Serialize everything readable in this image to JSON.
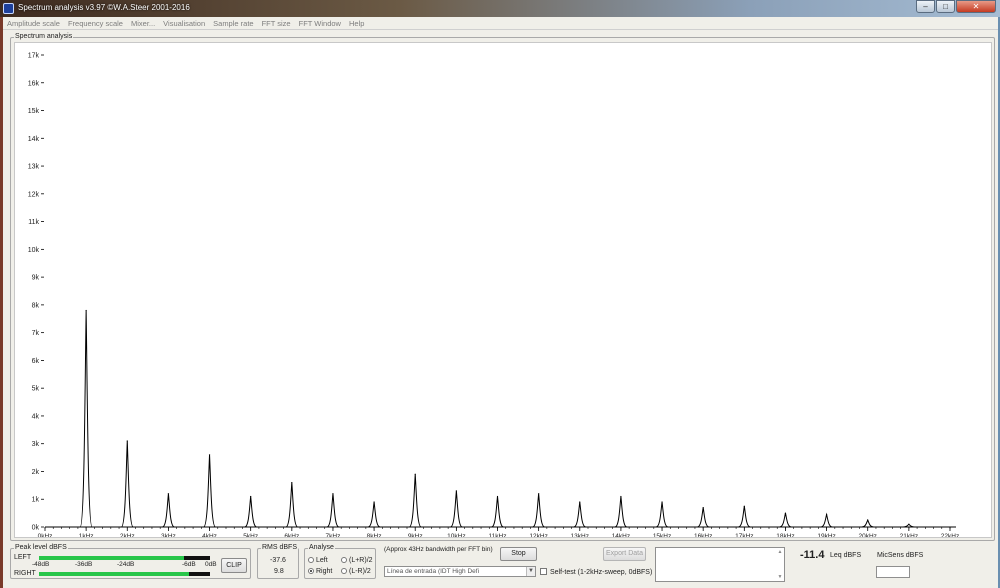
{
  "window": {
    "title": "Spectrum analysis v3.97   ©W.A.Steer 2001-2016",
    "controls": [
      "–",
      "□",
      "✕"
    ]
  },
  "menu": [
    "Amplitude scale",
    "Frequency scale",
    "Mixer...",
    "Visualisation",
    "Sample rate",
    "FFT size",
    "FFT Window",
    "Help"
  ],
  "spectrum": {
    "group_title": "Spectrum analysis",
    "y_ticks": [
      "0k",
      "1k",
      "2k",
      "3k",
      "4k",
      "5k",
      "6k",
      "7k",
      "8k",
      "9k",
      "10k",
      "11k",
      "12k",
      "13k",
      "14k",
      "15k",
      "16k",
      "17k"
    ],
    "x_ticks": [
      "0kHz",
      "1kHz",
      "2kHz",
      "3kHz",
      "4kHz",
      "5kHz",
      "6kHz",
      "7kHz",
      "8kHz",
      "9kHz",
      "10kHz",
      "11kHz",
      "12kHz",
      "13kHz",
      "14kHz",
      "15kHz",
      "16kHz",
      "17kHz",
      "18kHz",
      "19kHz",
      "20kHz",
      "21kHz",
      "22kHz"
    ],
    "colors": {
      "trace": "#000000",
      "background": "#ffffff"
    }
  },
  "chart_data": {
    "type": "line",
    "x_unit": "kHz",
    "xlim": [
      0,
      22
    ],
    "ylim": [
      0,
      17
    ],
    "peaks": [
      {
        "x": 1,
        "y": 7.8
      },
      {
        "x": 2,
        "y": 3.1
      },
      {
        "x": 3,
        "y": 1.2
      },
      {
        "x": 4,
        "y": 2.6
      },
      {
        "x": 5,
        "y": 1.1
      },
      {
        "x": 6,
        "y": 1.6
      },
      {
        "x": 7,
        "y": 1.2
      },
      {
        "x": 8,
        "y": 0.9
      },
      {
        "x": 9,
        "y": 1.9
      },
      {
        "x": 10,
        "y": 1.3
      },
      {
        "x": 11,
        "y": 1.1
      },
      {
        "x": 12,
        "y": 1.2
      },
      {
        "x": 13,
        "y": 0.9
      },
      {
        "x": 14,
        "y": 1.1
      },
      {
        "x": 15,
        "y": 0.9
      },
      {
        "x": 16,
        "y": 0.7
      },
      {
        "x": 17,
        "y": 0.75
      },
      {
        "x": 18,
        "y": 0.5
      },
      {
        "x": 19,
        "y": 0.45
      },
      {
        "x": 20,
        "y": 0.25
      },
      {
        "x": 21,
        "y": 0.1
      }
    ]
  },
  "peak_level": {
    "title": "Peak level dBFS",
    "left_label": "LEFT",
    "right_label": "RIGHT",
    "scale": [
      "-48dB",
      "-36dB",
      "-24dB",
      "-6dB",
      "0dB"
    ],
    "left_fraction": 0.85,
    "right_fraction": 0.88,
    "clip_label": "CLIP"
  },
  "rms": {
    "title": "RMS dBFS",
    "left": "-37.6",
    "right": "9.8"
  },
  "analyse": {
    "title": "Analyse",
    "options": [
      "Left",
      "(L+R)/2",
      "Right",
      "(L-R)/2"
    ],
    "selected": "Right"
  },
  "fft_info": "(Approx 43Hz bandwidth per FFT bin)",
  "stop_label": "Stop",
  "export_label": "Export Data",
  "input_select": "Línea de entrada (IDT High Defi",
  "selftest_label": "Self-test (1-2kHz-sweep, 0dBFS)",
  "leq": {
    "value": "-11.4",
    "label": "Leq dBFS"
  },
  "micsens_label": "MicSens dBFS"
}
